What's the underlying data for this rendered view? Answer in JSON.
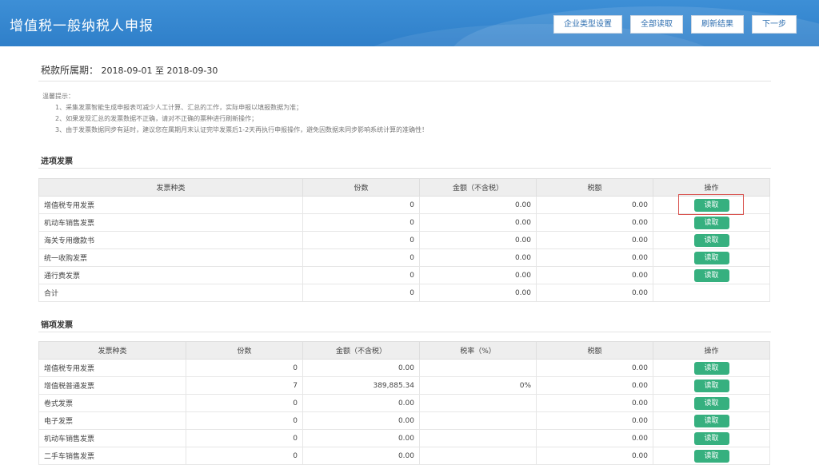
{
  "app_title": "增值税一般纳税人申报",
  "toolbar": {
    "buttons": [
      "企业类型设置",
      "全部读取",
      "刷新结果",
      "下一步"
    ]
  },
  "period": {
    "label": "税款所属期：",
    "start": "2018-09-01",
    "separator": "至",
    "end": "2018-09-30"
  },
  "tips": {
    "title": "温馨提示：",
    "lines": [
      "1、采集发票智能生成申报表可减少人工计算、汇总的工作，实际申报以填报数据为准；",
      "2、如果发现汇总的发票数据不正确，请对不正确的票种进行刷新操作；",
      "3、由于发票数据同步有延时，建议您在属期月末认证完毕发票后1-2天再执行申报操作，避免因数据未同步影响系统计算的准确性！"
    ]
  },
  "input_section": {
    "title": "进项发票",
    "columns": [
      "发票种类",
      "份数",
      "金额（不含税）",
      "税额",
      "操作"
    ],
    "rows": [
      {
        "type": "增值税专用发票",
        "count": "0",
        "amount": "0.00",
        "tax": "0.00",
        "action": "读取"
      },
      {
        "type": "机动车销售发票",
        "count": "0",
        "amount": "0.00",
        "tax": "0.00",
        "action": "读取"
      },
      {
        "type": "海关专用缴款书",
        "count": "0",
        "amount": "0.00",
        "tax": "0.00",
        "action": "读取"
      },
      {
        "type": "统一收购发票",
        "count": "0",
        "amount": "0.00",
        "tax": "0.00",
        "action": "读取"
      },
      {
        "type": "通行费发票",
        "count": "0",
        "amount": "0.00",
        "tax": "0.00",
        "action": "读取"
      },
      {
        "type": "合计",
        "count": "0",
        "amount": "0.00",
        "tax": "0.00",
        "action": ""
      }
    ]
  },
  "output_section": {
    "title": "销项发票",
    "columns": [
      "发票种类",
      "份数",
      "金额（不含税）",
      "税率（%）",
      "税额",
      "操作"
    ],
    "rows": [
      {
        "type": "增值税专用发票",
        "count": "0",
        "amount": "0.00",
        "rate": "",
        "tax": "0.00",
        "action": "读取"
      },
      {
        "type": "增值税普通发票",
        "count": "7",
        "amount": "389,885.34",
        "rate": "0%",
        "tax": "0.00",
        "action": "读取"
      },
      {
        "type": "卷式发票",
        "count": "0",
        "amount": "0.00",
        "rate": "",
        "tax": "0.00",
        "action": "读取"
      },
      {
        "type": "电子发票",
        "count": "0",
        "amount": "0.00",
        "rate": "",
        "tax": "0.00",
        "action": "读取"
      },
      {
        "type": "机动车销售发票",
        "count": "0",
        "amount": "0.00",
        "rate": "",
        "tax": "0.00",
        "action": "读取"
      },
      {
        "type": "二手车销售发票",
        "count": "0",
        "amount": "0.00",
        "rate": "",
        "tax": "0.00",
        "action": "读取"
      }
    ]
  },
  "colors": {
    "header_bg": "#2f7fc9",
    "read_button": "#36b07f",
    "highlight_border": "#d9534f"
  }
}
